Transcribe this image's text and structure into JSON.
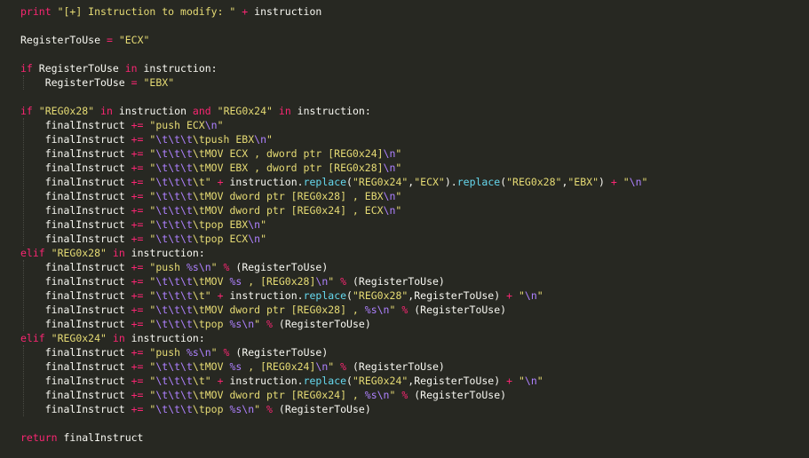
{
  "editor": {
    "theme": {
      "background": "#272822",
      "text": "#f8f8f2",
      "keyword": "#f92672",
      "string": "#e6db74",
      "escape": "#ae81ff",
      "function": "#66d9ef"
    },
    "lines": [
      [
        [
          "kw",
          "print"
        ],
        [
          "pl",
          " "
        ],
        [
          "str",
          "\"[+] Instruction to modify: \""
        ],
        [
          "pl",
          " "
        ],
        [
          "kw",
          "+"
        ],
        [
          "pl",
          " instruction"
        ]
      ],
      [],
      [
        [
          "pl",
          "RegisterToUse "
        ],
        [
          "kw",
          "="
        ],
        [
          "pl",
          " "
        ],
        [
          "str",
          "\"ECX\""
        ]
      ],
      [],
      [
        [
          "kw",
          "if"
        ],
        [
          "pl",
          " RegisterToUse "
        ],
        [
          "kw",
          "in"
        ],
        [
          "pl",
          " instruction:"
        ]
      ],
      [
        [
          "pl",
          "    RegisterToUse "
        ],
        [
          "kw",
          "="
        ],
        [
          "pl",
          " "
        ],
        [
          "str",
          "\"EBX\""
        ]
      ],
      [],
      [
        [
          "kw",
          "if"
        ],
        [
          "pl",
          " "
        ],
        [
          "str",
          "\"REG0x28\""
        ],
        [
          "pl",
          " "
        ],
        [
          "kw",
          "in"
        ],
        [
          "pl",
          " instruction "
        ],
        [
          "kw",
          "and"
        ],
        [
          "pl",
          " "
        ],
        [
          "str",
          "\"REG0x24\""
        ],
        [
          "pl",
          " "
        ],
        [
          "kw",
          "in"
        ],
        [
          "pl",
          " instruction:"
        ]
      ],
      [
        [
          "pl",
          "    finalInstruct "
        ],
        [
          "kw",
          "+="
        ],
        [
          "pl",
          " "
        ],
        [
          "str",
          "\"push ECX"
        ],
        [
          "esc",
          "\\n"
        ],
        [
          "str",
          "\""
        ]
      ],
      [
        [
          "pl",
          "    finalInstruct "
        ],
        [
          "kw",
          "+="
        ],
        [
          "pl",
          " "
        ],
        [
          "str",
          "\""
        ],
        [
          "esc",
          "\\t\\t\\t"
        ],
        [
          "str",
          "\\tpush EBX"
        ],
        [
          "esc",
          "\\n"
        ],
        [
          "str",
          "\""
        ]
      ],
      [
        [
          "pl",
          "    finalInstruct "
        ],
        [
          "kw",
          "+="
        ],
        [
          "pl",
          " "
        ],
        [
          "str",
          "\""
        ],
        [
          "esc",
          "\\t\\t\\t"
        ],
        [
          "str",
          "\\tMOV ECX , dword ptr [REG0x24]"
        ],
        [
          "esc",
          "\\n"
        ],
        [
          "str",
          "\""
        ]
      ],
      [
        [
          "pl",
          "    finalInstruct "
        ],
        [
          "kw",
          "+="
        ],
        [
          "pl",
          " "
        ],
        [
          "str",
          "\""
        ],
        [
          "esc",
          "\\t\\t\\t"
        ],
        [
          "str",
          "\\tMOV EBX , dword ptr [REG0x28]"
        ],
        [
          "esc",
          "\\n"
        ],
        [
          "str",
          "\""
        ]
      ],
      [
        [
          "pl",
          "    finalInstruct "
        ],
        [
          "kw",
          "+="
        ],
        [
          "pl",
          " "
        ],
        [
          "str",
          "\""
        ],
        [
          "esc",
          "\\t\\t\\t"
        ],
        [
          "str",
          "\\t\""
        ],
        [
          "pl",
          " "
        ],
        [
          "kw",
          "+"
        ],
        [
          "pl",
          " instruction."
        ],
        [
          "fn",
          "replace"
        ],
        [
          "pl",
          "("
        ],
        [
          "str",
          "\"REG0x24\""
        ],
        [
          "pl",
          ","
        ],
        [
          "str",
          "\"ECX\""
        ],
        [
          "pl",
          ")."
        ],
        [
          "fn",
          "replace"
        ],
        [
          "pl",
          "("
        ],
        [
          "str",
          "\"REG0x28\""
        ],
        [
          "pl",
          ","
        ],
        [
          "str",
          "\"EBX\""
        ],
        [
          "pl",
          ") "
        ],
        [
          "kw",
          "+"
        ],
        [
          "pl",
          " "
        ],
        [
          "str",
          "\""
        ],
        [
          "esc",
          "\\n"
        ],
        [
          "str",
          "\""
        ]
      ],
      [
        [
          "pl",
          "    finalInstruct "
        ],
        [
          "kw",
          "+="
        ],
        [
          "pl",
          " "
        ],
        [
          "str",
          "\""
        ],
        [
          "esc",
          "\\t\\t\\t"
        ],
        [
          "str",
          "\\tMOV dword ptr [REG0x28] , EBX"
        ],
        [
          "esc",
          "\\n"
        ],
        [
          "str",
          "\""
        ]
      ],
      [
        [
          "pl",
          "    finalInstruct "
        ],
        [
          "kw",
          "+="
        ],
        [
          "pl",
          " "
        ],
        [
          "str",
          "\""
        ],
        [
          "esc",
          "\\t\\t\\t"
        ],
        [
          "str",
          "\\tMOV dword ptr [REG0x24] , ECX"
        ],
        [
          "esc",
          "\\n"
        ],
        [
          "str",
          "\""
        ]
      ],
      [
        [
          "pl",
          "    finalInstruct "
        ],
        [
          "kw",
          "+="
        ],
        [
          "pl",
          " "
        ],
        [
          "str",
          "\""
        ],
        [
          "esc",
          "\\t\\t\\t"
        ],
        [
          "str",
          "\\tpop EBX"
        ],
        [
          "esc",
          "\\n"
        ],
        [
          "str",
          "\""
        ]
      ],
      [
        [
          "pl",
          "    finalInstruct "
        ],
        [
          "kw",
          "+="
        ],
        [
          "pl",
          " "
        ],
        [
          "str",
          "\""
        ],
        [
          "esc",
          "\\t\\t\\t"
        ],
        [
          "str",
          "\\tpop ECX"
        ],
        [
          "esc",
          "\\n"
        ],
        [
          "str",
          "\""
        ]
      ],
      [
        [
          "kw",
          "elif"
        ],
        [
          "pl",
          " "
        ],
        [
          "str",
          "\"REG0x28\""
        ],
        [
          "pl",
          " "
        ],
        [
          "kw",
          "in"
        ],
        [
          "pl",
          " instruction:"
        ]
      ],
      [
        [
          "pl",
          "    finalInstruct "
        ],
        [
          "kw",
          "+="
        ],
        [
          "pl",
          " "
        ],
        [
          "str",
          "\"push "
        ],
        [
          "esc",
          "%s\\n"
        ],
        [
          "str",
          "\""
        ],
        [
          "pl",
          " "
        ],
        [
          "kw",
          "%"
        ],
        [
          "pl",
          " (RegisterToUse)"
        ]
      ],
      [
        [
          "pl",
          "    finalInstruct "
        ],
        [
          "kw",
          "+="
        ],
        [
          "pl",
          " "
        ],
        [
          "str",
          "\""
        ],
        [
          "esc",
          "\\t\\t\\t"
        ],
        [
          "str",
          "\\tMOV "
        ],
        [
          "esc",
          "%s"
        ],
        [
          "str",
          " , [REG0x28]"
        ],
        [
          "esc",
          "\\n"
        ],
        [
          "str",
          "\""
        ],
        [
          "pl",
          " "
        ],
        [
          "kw",
          "%"
        ],
        [
          "pl",
          " (RegisterToUse)"
        ]
      ],
      [
        [
          "pl",
          "    finalInstruct "
        ],
        [
          "kw",
          "+="
        ],
        [
          "pl",
          " "
        ],
        [
          "str",
          "\""
        ],
        [
          "esc",
          "\\t\\t\\t"
        ],
        [
          "str",
          "\\t\""
        ],
        [
          "pl",
          " "
        ],
        [
          "kw",
          "+"
        ],
        [
          "pl",
          " instruction."
        ],
        [
          "fn",
          "replace"
        ],
        [
          "pl",
          "("
        ],
        [
          "str",
          "\"REG0x28\""
        ],
        [
          "pl",
          ",RegisterToUse) "
        ],
        [
          "kw",
          "+"
        ],
        [
          "pl",
          " "
        ],
        [
          "str",
          "\""
        ],
        [
          "esc",
          "\\n"
        ],
        [
          "str",
          "\""
        ]
      ],
      [
        [
          "pl",
          "    finalInstruct "
        ],
        [
          "kw",
          "+="
        ],
        [
          "pl",
          " "
        ],
        [
          "str",
          "\""
        ],
        [
          "esc",
          "\\t\\t\\t"
        ],
        [
          "str",
          "\\tMOV dword ptr [REG0x28] , "
        ],
        [
          "esc",
          "%s\\n"
        ],
        [
          "str",
          "\""
        ],
        [
          "pl",
          " "
        ],
        [
          "kw",
          "%"
        ],
        [
          "pl",
          " (RegisterToUse)"
        ]
      ],
      [
        [
          "pl",
          "    finalInstruct "
        ],
        [
          "kw",
          "+="
        ],
        [
          "pl",
          " "
        ],
        [
          "str",
          "\""
        ],
        [
          "esc",
          "\\t\\t\\t"
        ],
        [
          "str",
          "\\tpop "
        ],
        [
          "esc",
          "%s\\n"
        ],
        [
          "str",
          "\""
        ],
        [
          "pl",
          " "
        ],
        [
          "kw",
          "%"
        ],
        [
          "pl",
          " (RegisterToUse)"
        ]
      ],
      [
        [
          "kw",
          "elif"
        ],
        [
          "pl",
          " "
        ],
        [
          "str",
          "\"REG0x24\""
        ],
        [
          "pl",
          " "
        ],
        [
          "kw",
          "in"
        ],
        [
          "pl",
          " instruction:"
        ]
      ],
      [
        [
          "pl",
          "    finalInstruct "
        ],
        [
          "kw",
          "+="
        ],
        [
          "pl",
          " "
        ],
        [
          "str",
          "\"push "
        ],
        [
          "esc",
          "%s\\n"
        ],
        [
          "str",
          "\""
        ],
        [
          "pl",
          " "
        ],
        [
          "kw",
          "%"
        ],
        [
          "pl",
          " (RegisterToUse)"
        ]
      ],
      [
        [
          "pl",
          "    finalInstruct "
        ],
        [
          "kw",
          "+="
        ],
        [
          "pl",
          " "
        ],
        [
          "str",
          "\""
        ],
        [
          "esc",
          "\\t\\t\\t"
        ],
        [
          "str",
          "\\tMOV "
        ],
        [
          "esc",
          "%s"
        ],
        [
          "str",
          " , [REG0x24]"
        ],
        [
          "esc",
          "\\n"
        ],
        [
          "str",
          "\""
        ],
        [
          "pl",
          " "
        ],
        [
          "kw",
          "%"
        ],
        [
          "pl",
          " (RegisterToUse)"
        ]
      ],
      [
        [
          "pl",
          "    finalInstruct "
        ],
        [
          "kw",
          "+="
        ],
        [
          "pl",
          " "
        ],
        [
          "str",
          "\""
        ],
        [
          "esc",
          "\\t\\t\\t"
        ],
        [
          "str",
          "\\t\""
        ],
        [
          "pl",
          " "
        ],
        [
          "kw",
          "+"
        ],
        [
          "pl",
          " instruction."
        ],
        [
          "fn",
          "replace"
        ],
        [
          "pl",
          "("
        ],
        [
          "str",
          "\"REG0x24\""
        ],
        [
          "pl",
          ",RegisterToUse) "
        ],
        [
          "kw",
          "+"
        ],
        [
          "pl",
          " "
        ],
        [
          "str",
          "\""
        ],
        [
          "esc",
          "\\n"
        ],
        [
          "str",
          "\""
        ]
      ],
      [
        [
          "pl",
          "    finalInstruct "
        ],
        [
          "kw",
          "+="
        ],
        [
          "pl",
          " "
        ],
        [
          "str",
          "\""
        ],
        [
          "esc",
          "\\t\\t\\t"
        ],
        [
          "str",
          "\\tMOV dword ptr [REG0x24] , "
        ],
        [
          "esc",
          "%s\\n"
        ],
        [
          "str",
          "\""
        ],
        [
          "pl",
          " "
        ],
        [
          "kw",
          "%"
        ],
        [
          "pl",
          " (RegisterToUse)"
        ]
      ],
      [
        [
          "pl",
          "    finalInstruct "
        ],
        [
          "kw",
          "+="
        ],
        [
          "pl",
          " "
        ],
        [
          "str",
          "\""
        ],
        [
          "esc",
          "\\t\\t\\t"
        ],
        [
          "str",
          "\\tpop "
        ],
        [
          "esc",
          "%s\\n"
        ],
        [
          "str",
          "\""
        ],
        [
          "pl",
          " "
        ],
        [
          "kw",
          "%"
        ],
        [
          "pl",
          " (RegisterToUse)"
        ]
      ],
      [],
      [
        [
          "kw",
          "return"
        ],
        [
          "pl",
          " finalInstruct"
        ]
      ]
    ]
  }
}
